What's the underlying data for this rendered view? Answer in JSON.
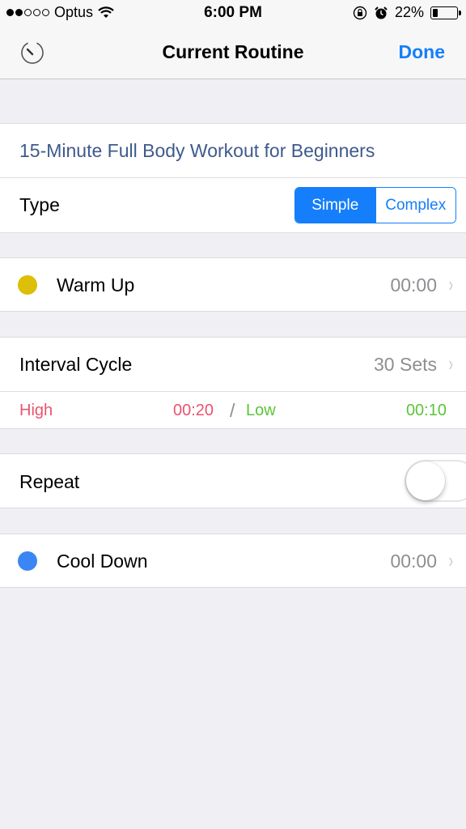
{
  "status_bar": {
    "carrier": "Optus",
    "signal_bars_filled": 2,
    "signal_bars_total": 5,
    "time": "6:00 PM",
    "battery_percent": "22%",
    "battery_level": 0.22
  },
  "nav": {
    "title": "Current Routine",
    "done_label": "Done",
    "left_icon": "timer-icon"
  },
  "routine": {
    "name": "15-Minute Full Body Workout for Beginners",
    "type_label": "Type",
    "type_options": [
      "Simple",
      "Complex"
    ],
    "type_selected": "Simple"
  },
  "warm_up": {
    "label": "Warm Up",
    "value": "00:00",
    "color": "#dcbf06"
  },
  "interval": {
    "label": "Interval Cycle",
    "value": "30 Sets",
    "high_label": "High",
    "high_value": "00:20",
    "divider": "/",
    "low_label": "Low",
    "low_value": "00:10",
    "high_color": "#e9546e",
    "low_color": "#5cc437"
  },
  "repeat": {
    "label": "Repeat",
    "enabled": false
  },
  "cool_down": {
    "label": "Cool Down",
    "value": "00:00",
    "color": "#3a86f5"
  },
  "chevron": "›"
}
